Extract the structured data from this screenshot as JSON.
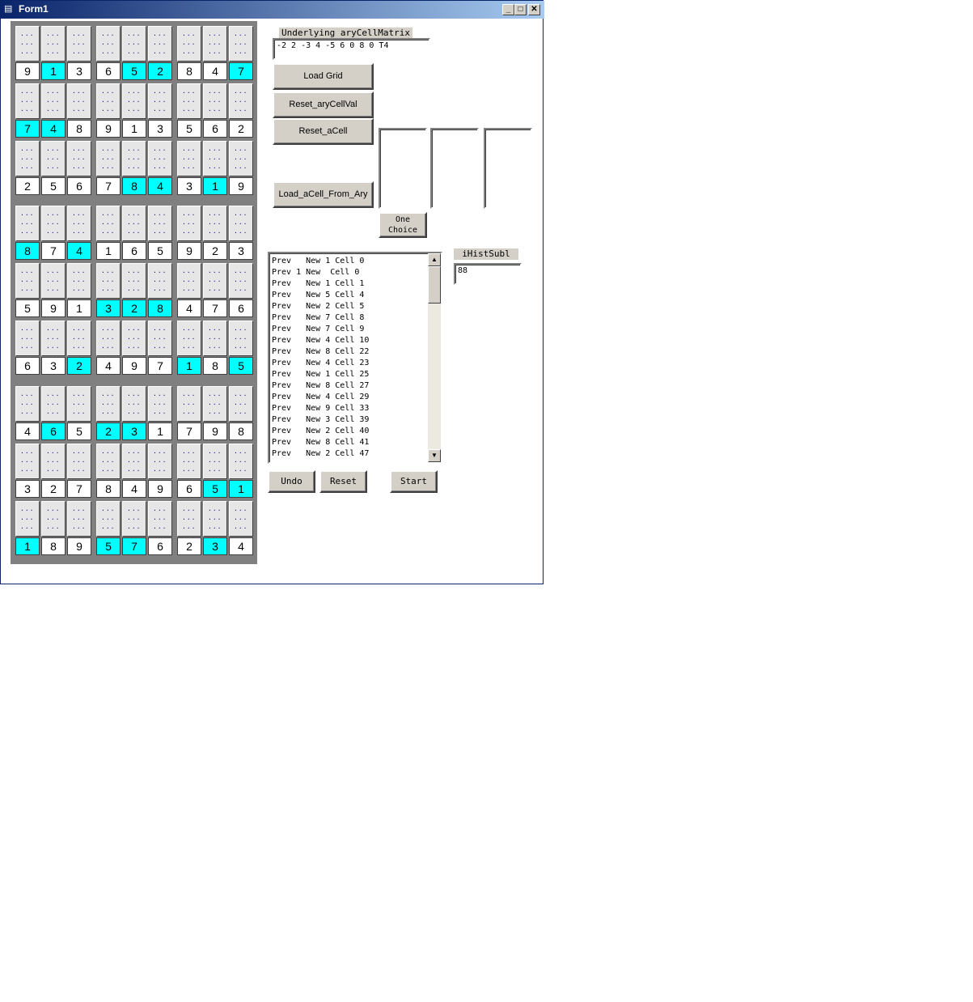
{
  "window": {
    "title": "Form1",
    "minimize": "_",
    "maximize": "□",
    "close": "✕"
  },
  "grid": {
    "hint_dots": "...\n...\n...",
    "rows": [
      [
        "9",
        "1",
        "3",
        "6",
        "5",
        "2",
        "8",
        "4",
        "7"
      ],
      [
        "7",
        "4",
        "8",
        "9",
        "1",
        "3",
        "5",
        "6",
        "2"
      ],
      [
        "2",
        "5",
        "6",
        "7",
        "8",
        "4",
        "3",
        "1",
        "9"
      ],
      [
        "8",
        "7",
        "4",
        "1",
        "6",
        "5",
        "9",
        "2",
        "3"
      ],
      [
        "5",
        "9",
        "1",
        "3",
        "2",
        "8",
        "4",
        "7",
        "6"
      ],
      [
        "6",
        "3",
        "2",
        "4",
        "9",
        "7",
        "1",
        "8",
        "5"
      ],
      [
        "4",
        "6",
        "5",
        "2",
        "3",
        "1",
        "7",
        "9",
        "8"
      ],
      [
        "3",
        "2",
        "7",
        "8",
        "4",
        "9",
        "6",
        "5",
        "1"
      ],
      [
        "1",
        "8",
        "9",
        "5",
        "7",
        "6",
        "2",
        "3",
        "4"
      ]
    ],
    "highlighted": [
      [
        0,
        1
      ],
      [
        0,
        4
      ],
      [
        0,
        5
      ],
      [
        0,
        8
      ],
      [
        1,
        0
      ],
      [
        1,
        1
      ],
      [
        2,
        4
      ],
      [
        2,
        5
      ],
      [
        2,
        7
      ],
      [
        3,
        0
      ],
      [
        3,
        2
      ],
      [
        4,
        3
      ],
      [
        4,
        4
      ],
      [
        4,
        5
      ],
      [
        5,
        2
      ],
      [
        5,
        6
      ],
      [
        5,
        8
      ],
      [
        6,
        1
      ],
      [
        6,
        3
      ],
      [
        6,
        4
      ],
      [
        7,
        7
      ],
      [
        7,
        8
      ],
      [
        8,
        0
      ],
      [
        8,
        3
      ],
      [
        8,
        4
      ],
      [
        8,
        7
      ]
    ],
    "highlight_color": "#00ffff"
  },
  "matrix": {
    "label": "Underlying aryCellMatrix",
    "value": "-2 2 -3 4 -5 6 0 8 0  T4"
  },
  "buttons": {
    "load_grid": "Load Grid",
    "reset_arycellval": "Reset_aryCellVal",
    "reset_acell": "Reset_aCell",
    "load_acell_from_ary": "Load_aCell_From_Ary",
    "one_choice": "One\nChoice",
    "undo": "Undo",
    "reset": "Reset",
    "start": "Start"
  },
  "history": {
    "lines": [
      "Prev   New 1 Cell 0",
      "Prev 1 New  Cell 0",
      "Prev   New 1 Cell 1",
      "Prev   New 5 Cell 4",
      "Prev   New 2 Cell 5",
      "Prev   New 7 Cell 8",
      "Prev   New 7 Cell 9",
      "Prev   New 4 Cell 10",
      "Prev   New 8 Cell 22",
      "Prev   New 4 Cell 23",
      "Prev   New 1 Cell 25",
      "Prev   New 8 Cell 27",
      "Prev   New 4 Cell 29",
      "Prev   New 9 Cell 33",
      "Prev   New 3 Cell 39",
      "Prev   New 2 Cell 40",
      "Prev   New 8 Cell 41",
      "Prev   New 2 Cell 47"
    ],
    "scroll_up": "▲",
    "scroll_down": "▼"
  },
  "ihist": {
    "label": "iHistSubl",
    "value": "88"
  }
}
